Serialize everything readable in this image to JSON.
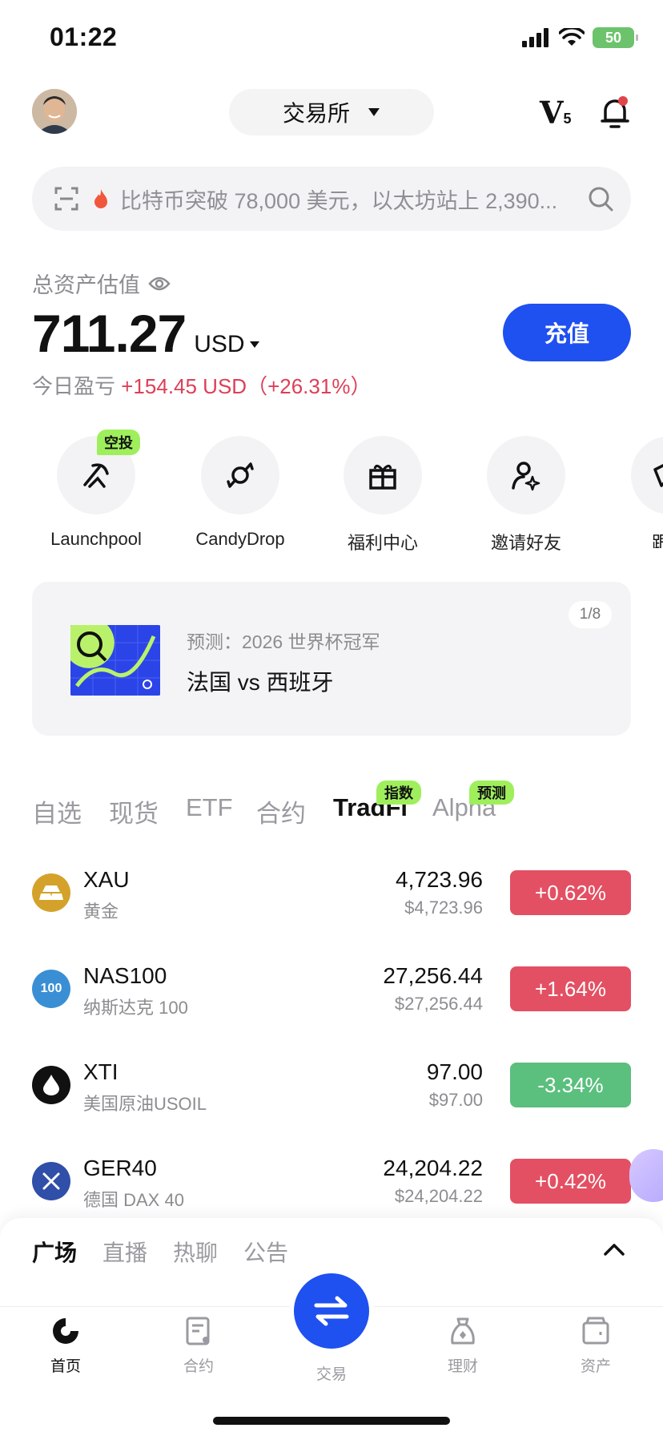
{
  "status_bar": {
    "time": "01:22",
    "battery": "50"
  },
  "header": {
    "exchange_label": "交易所",
    "vip_level": "V",
    "vip_sub": "5"
  },
  "search": {
    "placeholder": "比特币突破 78,000 美元，以太坊站上 2,390..."
  },
  "assets": {
    "label": "总资产估值",
    "value": "711.27",
    "currency": "USD",
    "deposit_label": "充值",
    "pnl_label": "今日盈亏",
    "pnl_value": "+154.45 USD（+26.31%）"
  },
  "quick_actions": [
    {
      "label": "Launchpool",
      "badge": "空投",
      "icon": "launchpool-icon"
    },
    {
      "label": "CandyDrop",
      "icon": "candy-icon"
    },
    {
      "label": "福利中心",
      "icon": "gift-icon"
    },
    {
      "label": "邀请好友",
      "icon": "invite-icon"
    },
    {
      "label": "跟",
      "icon": "copy-trade-icon"
    }
  ],
  "banner": {
    "subtitle": "预测：2026 世界杯冠军",
    "title": "法国 vs 西班牙",
    "page": "1/8"
  },
  "market_tabs": [
    {
      "label": "自选"
    },
    {
      "label": "现货"
    },
    {
      "label": "ETF"
    },
    {
      "label": "合约"
    },
    {
      "label": "TradFi",
      "badge": "指数",
      "active": true
    },
    {
      "label": "Alpha",
      "badge": "预测"
    }
  ],
  "markets": [
    {
      "symbol": "XAU",
      "name": "黄金",
      "price": "4,723.96",
      "price_usd": "$4,723.96",
      "change": "+0.62%",
      "direction": "up",
      "icon_color": "#d4a22a"
    },
    {
      "symbol": "NAS100",
      "name": "纳斯达克 100",
      "price": "27,256.44",
      "price_usd": "$27,256.44",
      "change": "+1.64%",
      "direction": "up",
      "icon_color": "#3a8fd4",
      "icon_text": "100"
    },
    {
      "symbol": "XTI",
      "name": "美国原油USOIL",
      "price": "97.00",
      "price_usd": "$97.00",
      "change": "-3.34%",
      "direction": "down",
      "icon_color": "#111111"
    },
    {
      "symbol": "GER40",
      "name": "德国 DAX 40",
      "price": "24,204.22",
      "price_usd": "$24,204.22",
      "change": "+0.42%",
      "direction": "up",
      "icon_color": "#2f4fa8"
    }
  ],
  "community_tabs": [
    {
      "label": "广场",
      "active": true
    },
    {
      "label": "直播"
    },
    {
      "label": "热聊"
    },
    {
      "label": "公告"
    }
  ],
  "bottom_nav": [
    {
      "label": "首页",
      "active": true,
      "icon": "home-icon"
    },
    {
      "label": "合约",
      "icon": "contract-icon"
    },
    {
      "label": "交易",
      "icon": "swap-icon"
    },
    {
      "label": "理财",
      "icon": "earn-icon"
    },
    {
      "label": "资产",
      "icon": "wallet-icon"
    }
  ],
  "colors": {
    "accent": "#1f50f0",
    "up": "#e35063",
    "down": "#5bbf7d",
    "badge": "#9fef5c"
  }
}
